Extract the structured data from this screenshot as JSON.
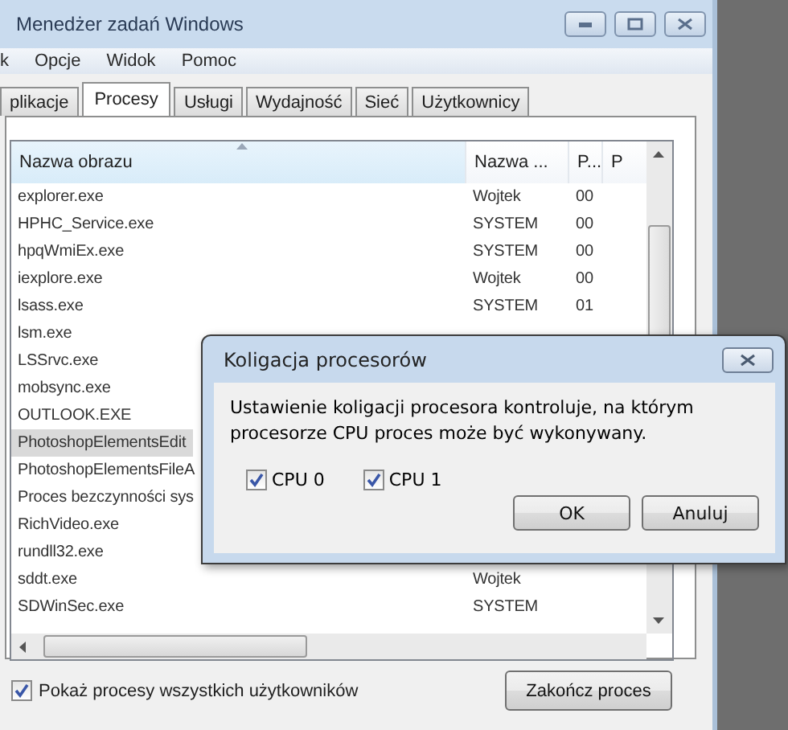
{
  "window": {
    "title": "Menedżer zadań Windows"
  },
  "menu": [
    {
      "label": "k"
    },
    {
      "label": "Opcje"
    },
    {
      "label": "Widok"
    },
    {
      "label": "Pomoc"
    }
  ],
  "tabs": [
    {
      "label": "plikacje",
      "selected": false
    },
    {
      "label": "Procesy",
      "selected": true
    },
    {
      "label": "Usługi",
      "selected": false
    },
    {
      "label": "Wydajność",
      "selected": false
    },
    {
      "label": "Sieć",
      "selected": false
    },
    {
      "label": "Użytkownicy",
      "selected": false
    }
  ],
  "table": {
    "columns": [
      "Nazwa obrazu",
      "Nazwa ...",
      "P...",
      "P"
    ],
    "rows": [
      {
        "cells": [
          "explorer.exe",
          "Wojtek",
          "00"
        ],
        "selected": false
      },
      {
        "cells": [
          "HPHC_Service.exe",
          "SYSTEM",
          "00"
        ],
        "selected": false
      },
      {
        "cells": [
          "hpqWmiEx.exe",
          "SYSTEM",
          "00"
        ],
        "selected": false
      },
      {
        "cells": [
          "iexplore.exe",
          "Wojtek",
          "00"
        ],
        "selected": false
      },
      {
        "cells": [
          "lsass.exe",
          "SYSTEM",
          "01"
        ],
        "selected": false
      },
      {
        "cells": [
          "lsm.exe"
        ],
        "selected": false
      },
      {
        "cells": [
          "LSSrvc.exe"
        ],
        "selected": false
      },
      {
        "cells": [
          "mobsync.exe"
        ],
        "selected": false
      },
      {
        "cells": [
          "OUTLOOK.EXE"
        ],
        "selected": false
      },
      {
        "cells": [
          "PhotoshopElementsEdit"
        ],
        "selected": true
      },
      {
        "cells": [
          "PhotoshopElementsFileA"
        ],
        "selected": false
      },
      {
        "cells": [
          "Proces bezczynności sys"
        ],
        "selected": false
      },
      {
        "cells": [
          "RichVideo.exe"
        ],
        "selected": false
      },
      {
        "cells": [
          "rundll32.exe"
        ],
        "selected": false
      },
      {
        "cells": [
          "sddt.exe",
          "Wojtek"
        ],
        "selected": false
      },
      {
        "cells": [
          "SDWinSec.exe",
          "SYSTEM"
        ],
        "selected": false
      }
    ]
  },
  "show_all_users": {
    "label": "Pokaż procesy wszystkich użytkowników",
    "checked": true
  },
  "end_button": "Zakończ proces",
  "dialog": {
    "title": "Koligacja procesorów",
    "message": "Ustawienie koligacji procesora kontroluje, na którym procesorze CPU proces może być wykonywany.",
    "cpus": [
      {
        "label": "CPU 0",
        "checked": true
      },
      {
        "label": "CPU 1",
        "checked": true
      }
    ],
    "buttons": [
      "OK",
      "Anuluj"
    ]
  }
}
